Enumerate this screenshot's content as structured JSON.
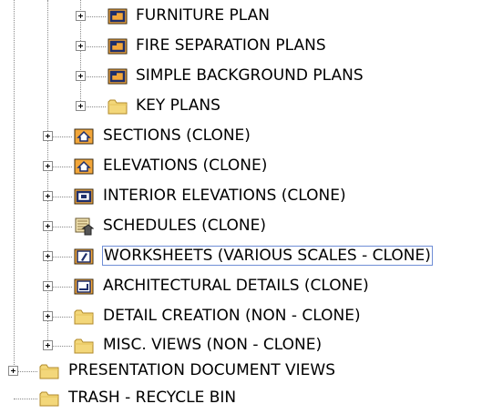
{
  "tree": {
    "items": [
      {
        "label": "FURNITURE PLAN",
        "icon": "plan-view-icon"
      },
      {
        "label": "FIRE SEPARATION PLANS",
        "icon": "plan-view-icon"
      },
      {
        "label": "SIMPLE BACKGROUND PLANS",
        "icon": "plan-view-icon"
      },
      {
        "label": "KEY PLANS",
        "icon": "folder-icon"
      },
      {
        "label": "SECTIONS (CLONE)",
        "icon": "section-icon"
      },
      {
        "label": "ELEVATIONS (CLONE)",
        "icon": "elevation-icon"
      },
      {
        "label": "INTERIOR ELEVATIONS (CLONE)",
        "icon": "interior-elevation-icon"
      },
      {
        "label": "SCHEDULES (CLONE)",
        "icon": "schedule-icon"
      },
      {
        "label": "WORKSHEETS (VARIOUS SCALES - CLONE)",
        "icon": "worksheet-icon"
      },
      {
        "label": "ARCHITECTURAL DETAILS (CLONE)",
        "icon": "detail-icon"
      },
      {
        "label": "DETAIL CREATION (NON - CLONE)",
        "icon": "folder-icon"
      },
      {
        "label": "MISC. VIEWS (NON - CLONE)",
        "icon": "folder-icon"
      },
      {
        "label": "PRESENTATION DOCUMENT VIEWS",
        "icon": "folder-icon"
      },
      {
        "label": "TRASH - RECYCLE BIN",
        "icon": "folder-icon"
      }
    ]
  },
  "colors": {
    "folder": "#f3d77a",
    "icon_orange": "#f2a63a",
    "icon_navy": "#1f2f6b",
    "selection_border": "#6f8ed6"
  }
}
